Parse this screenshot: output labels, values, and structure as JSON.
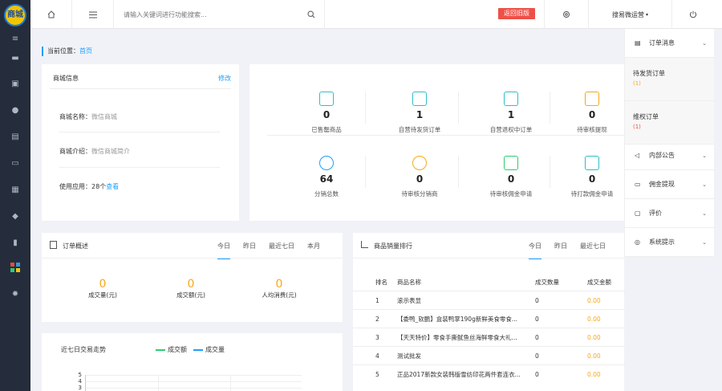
{
  "sidebar": {
    "logo_text": "商城",
    "icons": [
      "menu-toggle-icon",
      "store-icon",
      "order-icon",
      "user-icon",
      "document-icon",
      "card-icon",
      "gift-icon",
      "money-bag-icon",
      "chart-bar-icon",
      "apps-icon",
      "settings-icon"
    ]
  },
  "topbar": {
    "search_placeholder": "请输入关键词进行功能搜索...",
    "old_version": "返回旧版",
    "account": "搜易微运营"
  },
  "breadcrumb": {
    "label": "当前位置：",
    "link": "首页"
  },
  "shop_info": {
    "title": "商城信息",
    "edit": "修改",
    "name_label": "商城名称：",
    "name_value": "微信商城",
    "intro_label": "商城介绍：",
    "intro_value": "微信商城简介",
    "apps_label": "使用应用：",
    "apps_value": "28个",
    "apps_link": "查看"
  },
  "stats": [
    {
      "value": "0",
      "label": "已售罄商品"
    },
    {
      "value": "1",
      "label": "自营待发货订单"
    },
    {
      "value": "1",
      "label": "自营退权中订单"
    },
    {
      "value": "0",
      "label": "待审核提现"
    },
    {
      "value": "64",
      "label": "分销总数"
    },
    {
      "value": "0",
      "label": "待审核分销商"
    },
    {
      "value": "0",
      "label": "待审核佣金申请"
    },
    {
      "value": "0",
      "label": "待打款佣金申请"
    }
  ],
  "order_overview": {
    "title": "订单概述",
    "tabs": [
      "今日",
      "昨日",
      "最近七日",
      "本月"
    ],
    "metrics": [
      {
        "value": "0",
        "label": "成交量(元)"
      },
      {
        "value": "0",
        "label": "成交额(元)"
      },
      {
        "value": "0",
        "label": "人均消费(元)"
      }
    ]
  },
  "trend": {
    "title": "近七日交易走势",
    "legend": [
      "成交额",
      "成交量"
    ],
    "y_ticks": [
      "5",
      "4",
      "3"
    ]
  },
  "ranking": {
    "title": "商品销量排行",
    "tabs": [
      "今日",
      "昨日",
      "最近七日"
    ],
    "headers": [
      "排名",
      "商品名称",
      "成交数量",
      "成交金额"
    ],
    "rows": [
      {
        "rank": "1",
        "name": "滚示表显",
        "qty": "0",
        "amount": "0.00"
      },
      {
        "rank": "2",
        "name": "【委鸭_软鹏】盒装鸭掌190g新鲜美食零食...",
        "qty": "0",
        "amount": "0.00"
      },
      {
        "rank": "3",
        "name": "【天天特价】零食手撕鱿鱼丝海鲜零食大礼...",
        "qty": "0",
        "amount": "0.00"
      },
      {
        "rank": "4",
        "name": "测试批发",
        "qty": "0",
        "amount": "0.00"
      },
      {
        "rank": "5",
        "name": "正品2017新款女装韩版雪纺印花两件套连衣...",
        "qty": "0",
        "amount": "0.00"
      }
    ]
  },
  "right_panel": {
    "order_msg": "订单消息",
    "pending_ship": "待发货订单",
    "pending_ship_count": "(1)",
    "refund": "维权订单",
    "refund_count": "(1)",
    "notice": "内部公告",
    "commission": "佣金提现",
    "review": "评价",
    "system": "系统提示"
  },
  "colors": {
    "accent": "#1e9fff",
    "danger": "#ee5047",
    "orange": "#f7a81b",
    "sidebar": "#252d3d",
    "teal": "#2ebfc7"
  }
}
